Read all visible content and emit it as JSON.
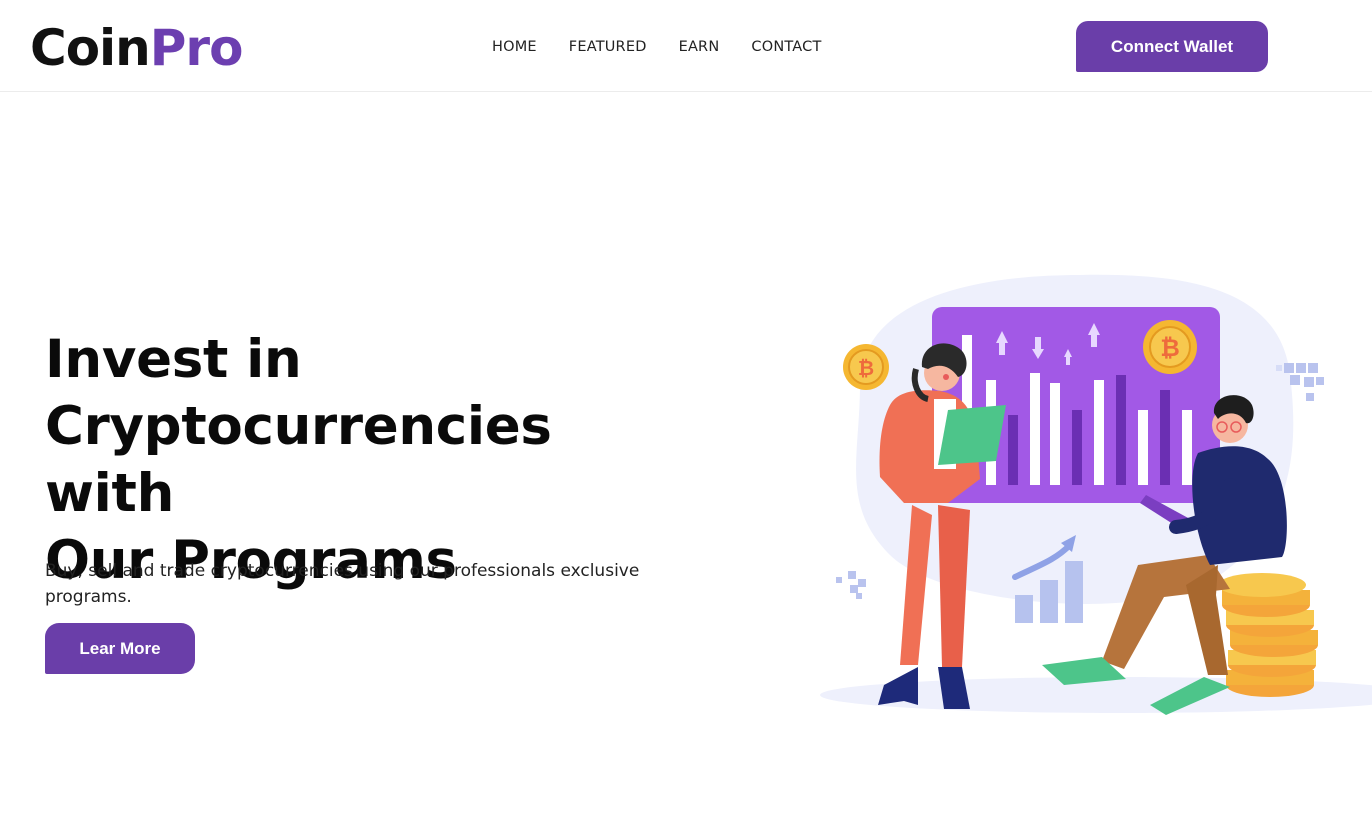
{
  "brand": {
    "part1": "Coin",
    "part2": "Pro"
  },
  "nav": {
    "items": [
      {
        "label": "HOME"
      },
      {
        "label": "FEATURED"
      },
      {
        "label": "EARN"
      },
      {
        "label": "CONTACT"
      }
    ],
    "cta_label": "Connect Wallet"
  },
  "hero": {
    "title_line1": "Invest in",
    "title_line2": "Cryptocurrencies with",
    "title_line3": "Our Programs",
    "subtitle": "Buy, sell and trade cryptocurrencies using our professionals exclusive programs.",
    "button_label": "Lear More"
  },
  "colors": {
    "accent": "#6a3ea9",
    "board": "#a259e6",
    "coin": "#f5b731",
    "blob": "#eef0fc"
  },
  "icons": [
    "bitcoin-icon",
    "arrow-up-icon",
    "trend-arrow-icon"
  ]
}
